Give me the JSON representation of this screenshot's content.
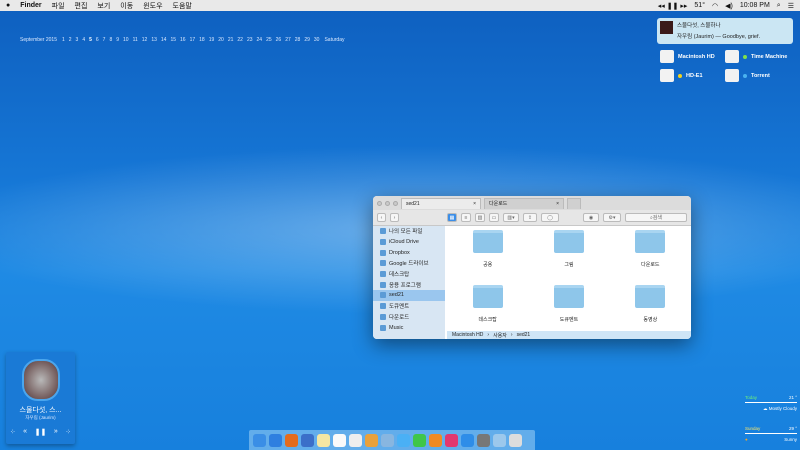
{
  "menubar": {
    "app": "Finder",
    "items": [
      "파일",
      "편집",
      "보기",
      "이동",
      "윈도우",
      "도움말"
    ],
    "battery": "51°",
    "time": "10:08 PM"
  },
  "calendar": {
    "month": "September 2015",
    "days": [
      "1",
      "2",
      "3",
      "4",
      "5",
      "6",
      "7",
      "8",
      "9",
      "10",
      "11",
      "12",
      "13",
      "14",
      "15",
      "16",
      "17",
      "18",
      "19",
      "20",
      "21",
      "22",
      "23",
      "24",
      "25",
      "26",
      "27",
      "28",
      "29",
      "30"
    ],
    "today_index": 4,
    "weekday": "Saturday"
  },
  "notification": {
    "title": "스물다섯, 스물하나",
    "subtitle": "자우림 (Jaurim) — Goodbye, grief."
  },
  "drives": [
    {
      "name": "Macintosh HD",
      "dot": ""
    },
    {
      "name": "Time Machine",
      "dot": "#7fe04a"
    },
    {
      "name": "HD-E1",
      "dot": "#f5d31a"
    },
    {
      "name": "Torrent",
      "dot": "#49b2f0"
    }
  ],
  "finder": {
    "tabs": [
      {
        "label": "sed21"
      },
      {
        "label": "다운로드"
      }
    ],
    "search_placeholder": "검색",
    "sidebar": [
      "나의 모든 파일",
      "iCloud Drive",
      "Dropbox",
      "Google 드라이브",
      "데스크탑",
      "응용 프로그램",
      "sed21",
      "도큐멘트",
      "다운로드",
      "Music"
    ],
    "selected": 6,
    "folders": [
      "공용",
      "그림",
      "다운로드",
      "데스크탑",
      "도큐멘트",
      "동영상"
    ],
    "path": [
      "Macintosh HD",
      "사용자",
      "sed21"
    ]
  },
  "player": {
    "title": "스물다섯, 스...",
    "artist": "자우림 (Jaurim)"
  },
  "weather": [
    {
      "day": "Today",
      "temp": "21 °",
      "cond": "Mostly Cloudy"
    },
    {
      "day": "Sunday",
      "temp": "29 °",
      "cond": "Sunny"
    }
  ],
  "dock_colors": [
    "#3a8ee6",
    "#2e7fe0",
    "#e46b1c",
    "#3b6fc9",
    "#f5e7a3",
    "#fafafa",
    "#eee",
    "#e9a13b",
    "#88b6e0",
    "#4ab0f5",
    "#3fc64a",
    "#f08a24",
    "#e3386f",
    "#2e8de8",
    "#777",
    "#9cc8ec",
    "#ddd"
  ]
}
